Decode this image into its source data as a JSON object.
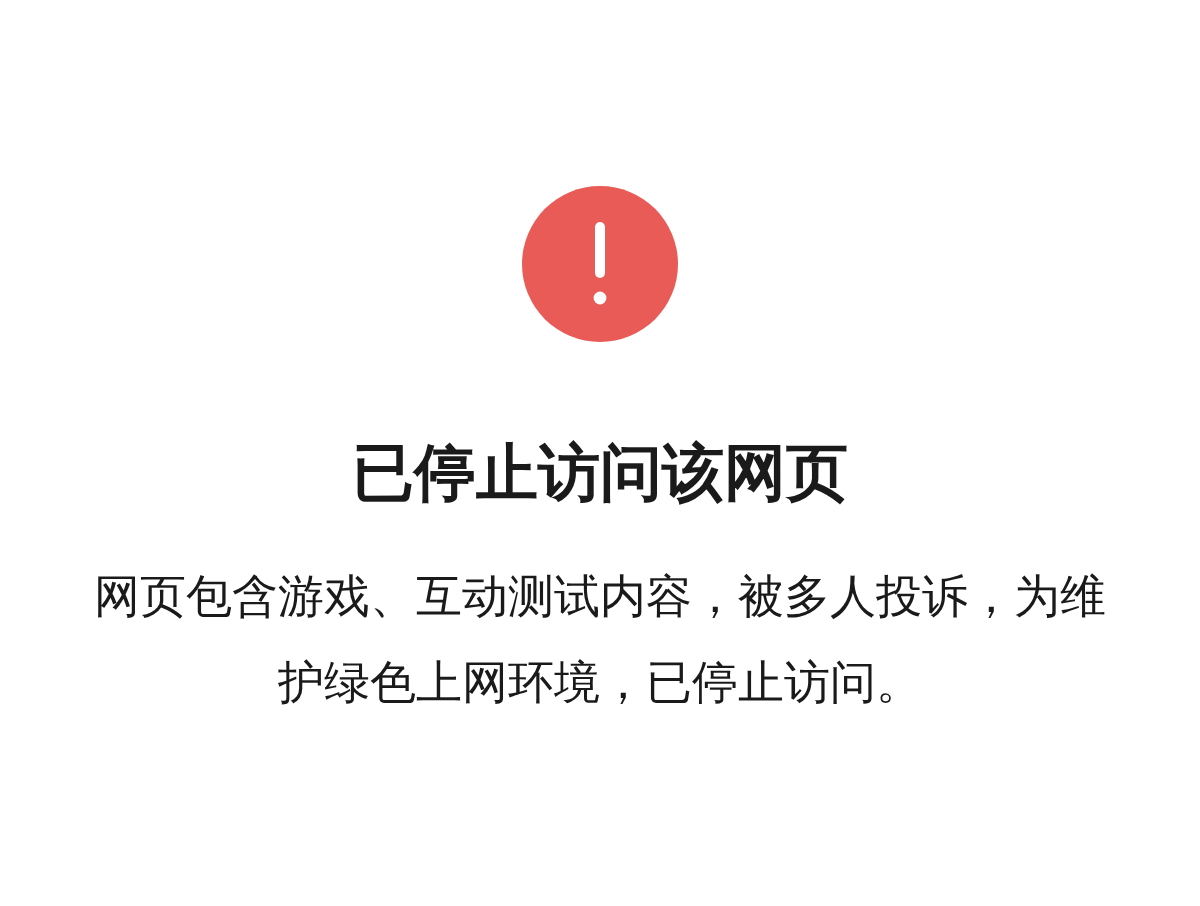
{
  "title": "已停止访问该网页",
  "message": "网页包含游戏、互动测试内容，被多人投诉，为维护绿色上网环境，已停止访问。"
}
